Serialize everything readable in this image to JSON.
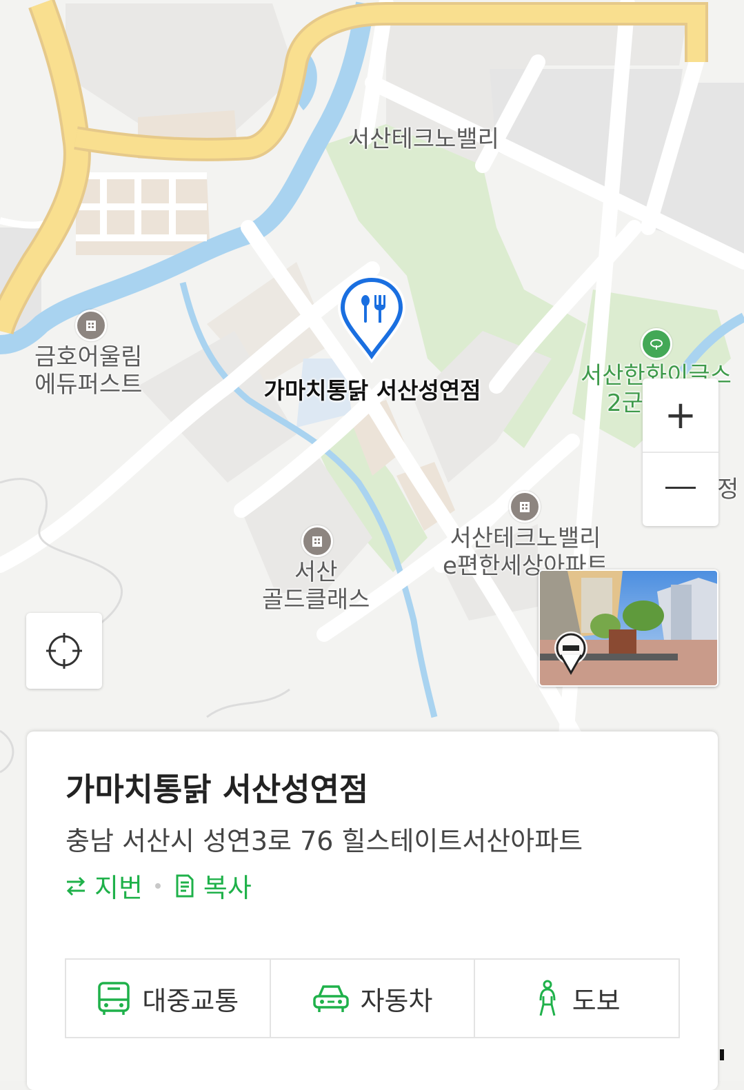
{
  "map": {
    "labels": {
      "techno_valley": "서산테크노밸리",
      "kumho": "금호어울림\n에듀퍼스트",
      "golf": "서산한화이글스\n2군",
      "seosan_gold": "서산\n골드클래스",
      "techno_apt": "서산테크노밸리\ne편한세상아파트",
      "edge": "정"
    },
    "poi_icon_names": [
      "apartment-icon",
      "golf-icon"
    ]
  },
  "pin": {
    "label": "가마치통닭 서산성연점",
    "icon": "restaurant-pin-icon",
    "color": "#1a6fe0"
  },
  "zoom": {
    "in_label": "+",
    "out_label": "—"
  },
  "place": {
    "name": "가마치통닭 서산성연점",
    "address": "충남 서산시 성연3로 76 힐스테이트서산아파트",
    "lot_toggle_label": "지번",
    "copy_label": "복사"
  },
  "routes": [
    {
      "label": "대중교통",
      "icon": "bus-icon"
    },
    {
      "label": "자동차",
      "icon": "car-icon"
    },
    {
      "label": "도보",
      "icon": "walk-icon"
    }
  ],
  "colors": {
    "accent_green": "#1fb14a",
    "road_yellow": "#f9df8f",
    "water": "#a9d3f0",
    "park": "#dcecd0"
  }
}
